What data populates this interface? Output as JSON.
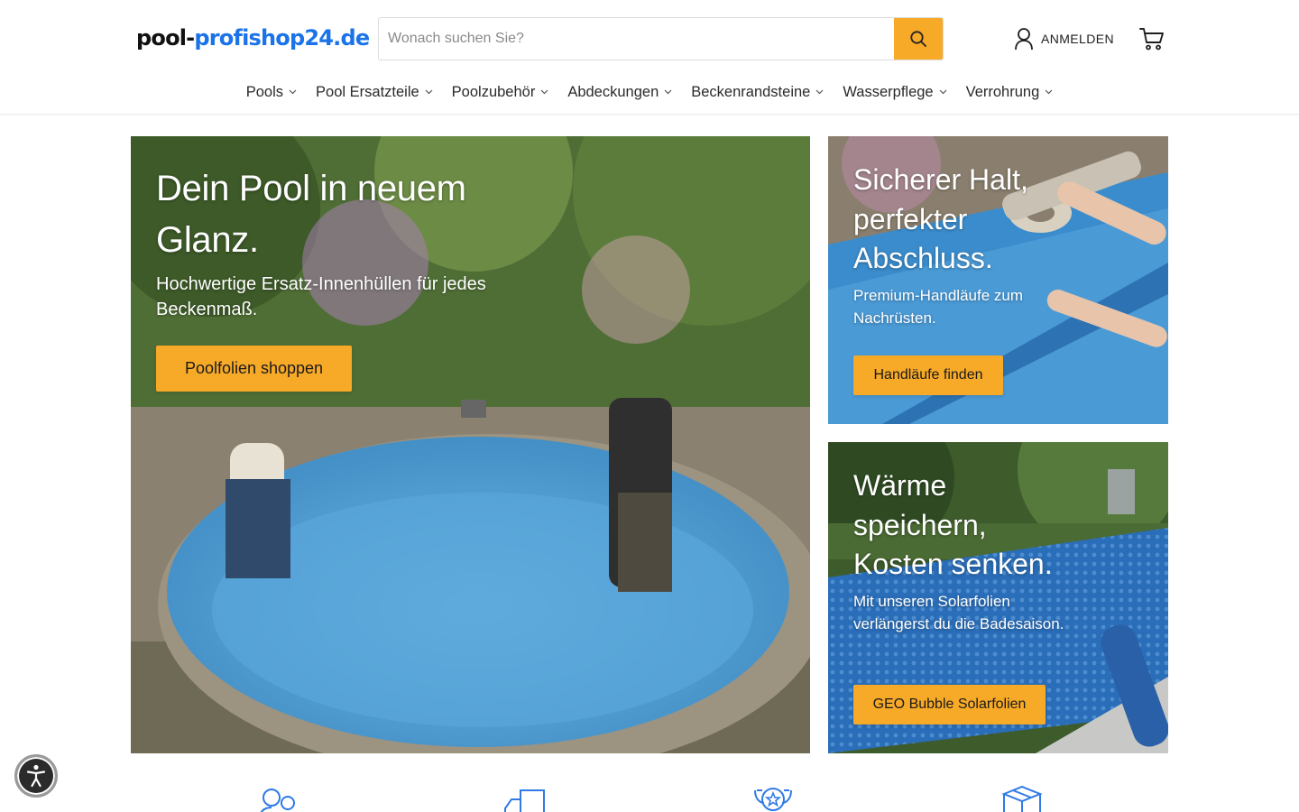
{
  "logo": {
    "part1": "pool-",
    "part2": "profishop24.de"
  },
  "search": {
    "placeholder": "Wonach suchen Sie?",
    "value": ""
  },
  "header": {
    "login_label": "ANMELDEN"
  },
  "nav": [
    {
      "label": "Pools"
    },
    {
      "label": "Pool Ersatzteile"
    },
    {
      "label": "Poolzubehör"
    },
    {
      "label": "Abdeckungen"
    },
    {
      "label": "Beckenrandsteine"
    },
    {
      "label": "Wasserpflege"
    },
    {
      "label": "Verrohrung"
    }
  ],
  "hero": {
    "title": "Dein Pool in neuem Glanz.",
    "subtitle": "Hochwertige Ersatz-Innenhüllen für jedes Beckenmaß.",
    "cta": "Poolfolien shoppen"
  },
  "promo_handrails": {
    "title": "Sicherer Halt, perfekter Abschluss.",
    "subtitle": "Premium-Handläufe zum Nachrüsten.",
    "cta": "Handläufe finden"
  },
  "promo_solar": {
    "title": "Wärme speichern, Kosten senken.",
    "subtitle": "Mit unseren Solarfolien verlängerst du die Badesaison.",
    "cta": "GEO Bubble Solarfolien"
  },
  "colors": {
    "accent": "#f7a928",
    "brand_blue": "#1a73e8",
    "icon_blue": "#2f7ae5"
  },
  "feature_icons": [
    "people-icon",
    "shipping-icon",
    "quality-badge-icon",
    "package-icon"
  ]
}
